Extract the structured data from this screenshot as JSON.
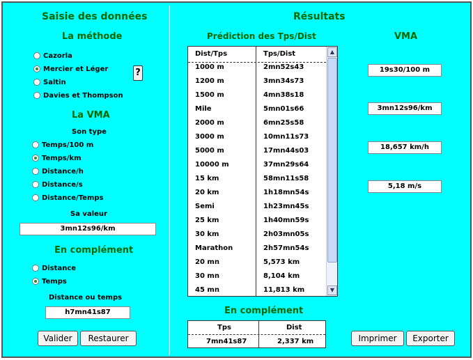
{
  "left": {
    "title": "Saisie des données",
    "methode_title": "La méthode",
    "methods": [
      {
        "label": "Cazorla",
        "selected": false
      },
      {
        "label": "Mercier et Léger",
        "selected": true
      },
      {
        "label": "Saltin",
        "selected": false
      },
      {
        "label": "Davies et Thompson",
        "selected": false
      }
    ],
    "help_label": "?",
    "vma_title": "La VMA",
    "type_title": "Son type",
    "types": [
      {
        "label": "Temps/100 m",
        "selected": false
      },
      {
        "label": "Temps/km",
        "selected": true
      },
      {
        "label": "Distance/h",
        "selected": false
      },
      {
        "label": "Distance/s",
        "selected": false
      },
      {
        "label": "Distance/Temps",
        "selected": false
      }
    ],
    "valeur_title": "Sa valeur",
    "valeur": "3mn12s96/km",
    "complement_title": "En complément",
    "complements": [
      {
        "label": "Distance",
        "selected": false
      },
      {
        "label": "Temps",
        "selected": true
      }
    ],
    "dist_temps_title": "Distance ou temps",
    "dist_temps_value": "h7mn41s87",
    "valider_label": "Valider",
    "restaurer_label": "Restaurer"
  },
  "right": {
    "title": "Résultats",
    "prediction_title": "Prédiction des Tps/Dist",
    "col_dist": "Dist/Tps",
    "col_tps": "Tps/Dist",
    "rows": [
      {
        "dist": "1000 m",
        "tps": "2mn52s43"
      },
      {
        "dist": "1200 m",
        "tps": "3mn34s73"
      },
      {
        "dist": "1500 m",
        "tps": "4mn38s18"
      },
      {
        "dist": "Mile",
        "tps": "5mn01s66"
      },
      {
        "dist": "2000 m",
        "tps": "6mn25s58"
      },
      {
        "dist": "3000 m",
        "tps": "10mn11s73"
      },
      {
        "dist": "5000 m",
        "tps": "17mn44s03"
      },
      {
        "dist": "10000 m",
        "tps": "37mn29s64"
      },
      {
        "dist": "15 km",
        "tps": "58mn11s58"
      },
      {
        "dist": "20 km",
        "tps": "1h18mn54s"
      },
      {
        "dist": "Semi",
        "tps": "1h23mn45s"
      },
      {
        "dist": "25 km",
        "tps": "1h40mn59s"
      },
      {
        "dist": "30 km",
        "tps": "2h03mn05s"
      },
      {
        "dist": "Marathon",
        "tps": "2h57mn54s"
      },
      {
        "dist": "20 mn",
        "tps": "5,573 km"
      },
      {
        "dist": "30 mn",
        "tps": "8,104 km"
      },
      {
        "dist": "45 mn",
        "tps": "11,813 km"
      }
    ],
    "vma_title": "VMA",
    "vma_values": [
      "19s30/100 m",
      "3mn12s96/km",
      "18,657 km/h",
      "5,18 m/s"
    ],
    "complement_title": "En complément",
    "comp_col_tps": "Tps",
    "comp_col_dist": "Dist",
    "comp_tps": "7mn41s87",
    "comp_dist": "2,337 km",
    "imprimer_label": "Imprimer",
    "exporter_label": "Exporter"
  },
  "icons": {
    "scroll_up": "arrow-up-icon",
    "scroll_down": "arrow-down-icon"
  },
  "colors": {
    "background": "#00ffff",
    "heading": "#006600",
    "radio_selected": "#2a8a2a"
  }
}
